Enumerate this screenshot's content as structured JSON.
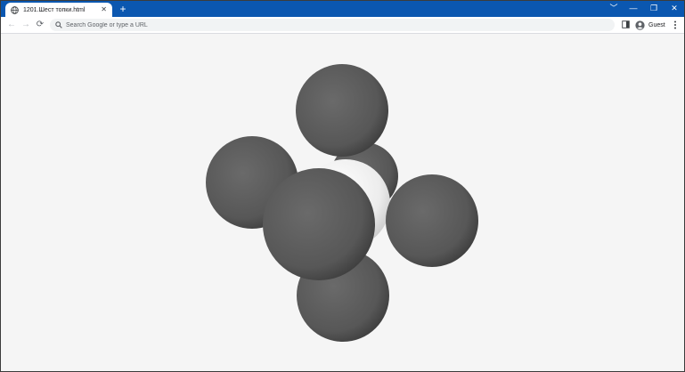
{
  "browser": {
    "tab": {
      "title": "1201.Шест топки.html",
      "favicon": "globe-icon",
      "close_symbol": "✕"
    },
    "new_tab_symbol": "+",
    "window_controls": {
      "tab_search": "﹀",
      "minimize": "—",
      "restore": "❐",
      "close": "✕"
    },
    "toolbar": {
      "back_icon": "←",
      "forward_icon": "→",
      "reload_icon": "⟳",
      "address_placeholder": "Search Google or type a URL",
      "address_value": "",
      "profile_label": "Guest"
    }
  },
  "scene": {
    "background": "#f5f5f5",
    "sphere_color_dark": "#5c5c5c",
    "sphere_color_light": "#f2f2f2",
    "spheres": [
      "back",
      "center",
      "top",
      "left",
      "right",
      "bottom",
      "front"
    ]
  },
  "colors": {
    "titlebar": "#0b57b0",
    "tab_background": "#ffffff",
    "omnibox": "#f1f3f4"
  }
}
